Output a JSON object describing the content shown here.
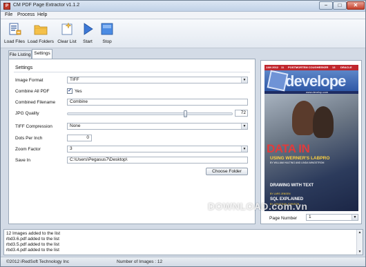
{
  "window": {
    "title": "CM PDF Page Extractor v1.1.2",
    "controls": {
      "minimize": "−",
      "maximize": "□",
      "close": "✕"
    }
  },
  "menu": [
    "File",
    "Process",
    "Help"
  ],
  "toolbar": {
    "load_files": "Load Files",
    "load_folders": "Load Folders",
    "clear_list": "Clear List",
    "start": "Start",
    "stop": "Stop"
  },
  "tabs": {
    "file_listing": "File Listing",
    "settings": "Settings"
  },
  "settings": {
    "group_title": "Settings",
    "image_format": {
      "label": "Image Format",
      "value": "TIFF"
    },
    "combine_all_pdf": {
      "label": "Combine All PDF",
      "checked": true,
      "check_label": "Yes",
      "check_mark": "✓"
    },
    "combined_filename": {
      "label": "Combined Filename",
      "value": "Combine"
    },
    "jpg_quality": {
      "label": "JPG Quality",
      "value": "72",
      "slider_fraction": 0.72
    },
    "tiff_compression": {
      "label": "TIFF Compression",
      "value": "None"
    },
    "dots_per_inch": {
      "label": "Dots Per Inch",
      "value": "0"
    },
    "zoom_factor": {
      "label": "Zoom Factor",
      "value": "3"
    },
    "save_in": {
      "label": "Save In",
      "value": "C:\\Users\\Pegasus7\\Desktop\\"
    },
    "choose_folder": "Choose Folder"
  },
  "preview": {
    "magazine": {
      "strip": [
        "JAN 2012",
        "11",
        "POSTMORTEM COUGHEEKER",
        "13",
        "DRACLE"
      ],
      "brand": "develope",
      "url": "www.develop.com",
      "headline": "DATA IN",
      "subhead": "USING WERNER'S LABPRO",
      "subhead_byline": "BY WILLIAM HULTING AND LINDA WINGSTROM",
      "story3": "DRAWING WITH TEXT",
      "story3_byline": "BY LARS JENSEN",
      "story4": "SQL EXPLAINED",
      "story4_byline": "BY JONATHAN JOHNSON"
    },
    "watermark": "DOWNLOAD.com.vn",
    "page_number_label": "Page Number",
    "page_number_value": "1"
  },
  "log": [
    "12 Images added to the list",
    "rbd3.6.pdf added to the list",
    "rbd3.5.pdf added to the list",
    "rbd3.4.pdf added to the list"
  ],
  "status": {
    "copyright": "©2012 iRedSoft Technology Inc",
    "image_count": "Number of Images : 12"
  },
  "icons": {
    "app": "pdf-app-icon",
    "load_files": "load-files-icon",
    "load_folders": "folder-icon",
    "clear_list": "clear-list-icon",
    "start": "play-icon",
    "stop": "stop-icon"
  }
}
